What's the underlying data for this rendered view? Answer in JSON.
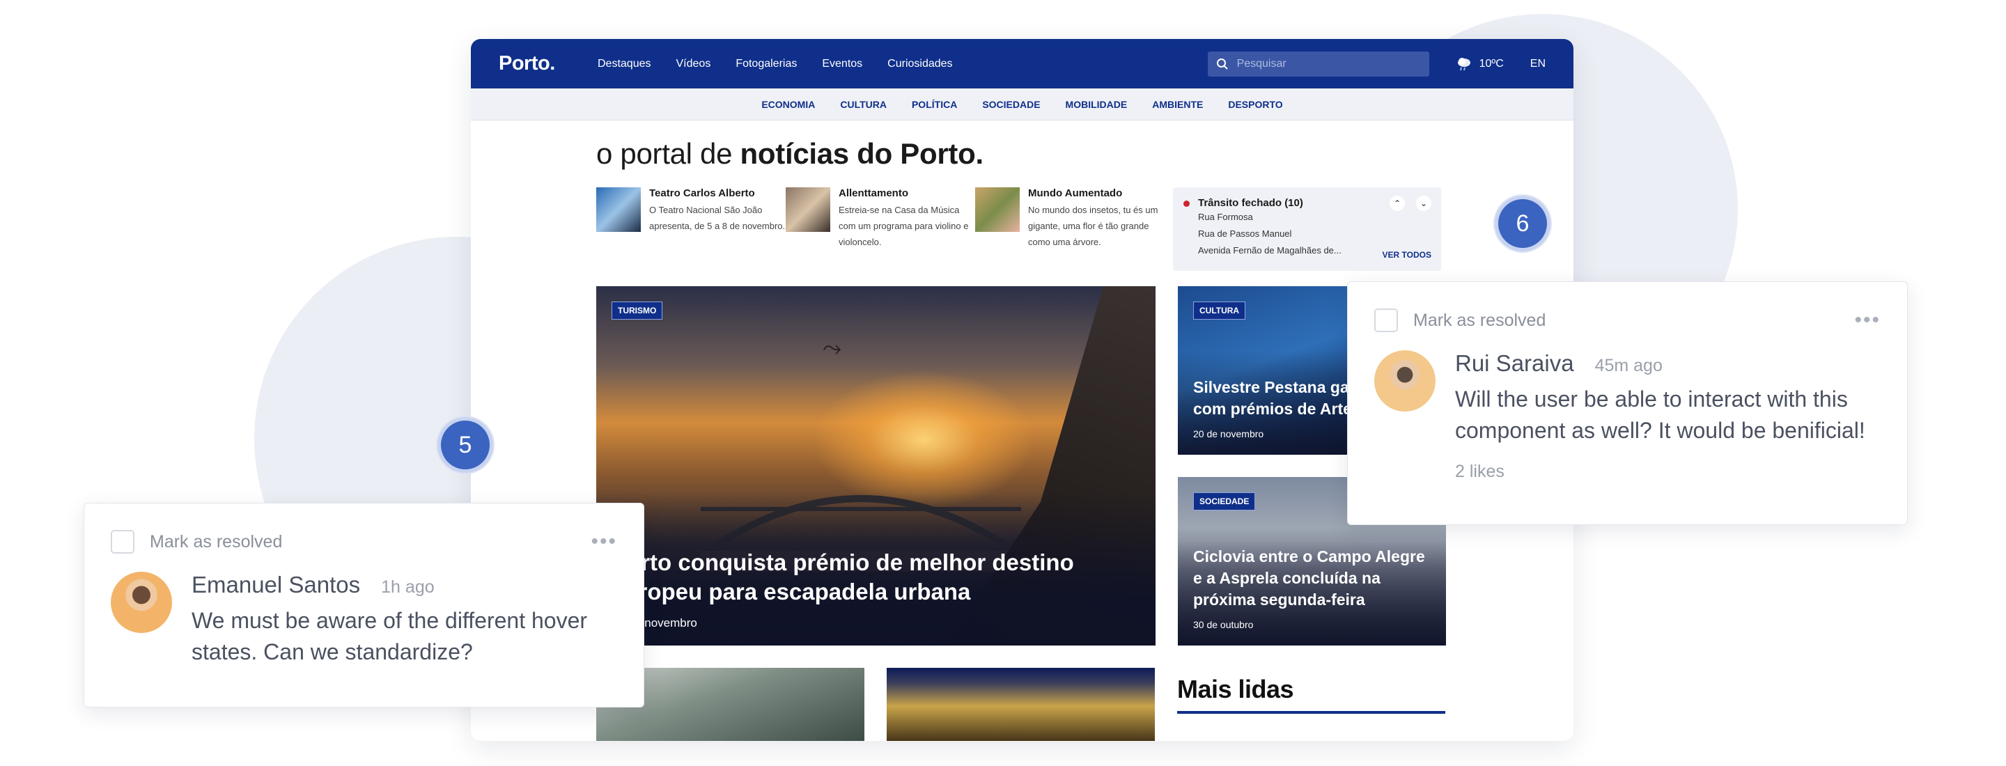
{
  "site": {
    "logo": "Porto.",
    "nav": [
      "Destaques",
      "Vídeos",
      "Fotogalerias",
      "Eventos",
      "Curiosidades"
    ],
    "search_placeholder": "Pesquisar",
    "weather": "10ºC",
    "lang": "EN",
    "categories": [
      "ECONOMIA",
      "CULTURA",
      "POLÍTICA",
      "SOCIEDADE",
      "MOBILIDADE",
      "AMBIENTE",
      "DESPORTO"
    ],
    "headline_light": "o portal de ",
    "headline_bold": "notícias do Porto.",
    "mini_news": [
      {
        "title": "Teatro Carlos Alberto",
        "text": "O Teatro Nacional São João apresenta, de 5 a 8 de novembro."
      },
      {
        "title": "Allenttamento",
        "text": "Estreia-se na Casa da Música com um programa para violino e violoncelo."
      },
      {
        "title": "Mundo Aumentado",
        "text": "No mundo dos insetos, tu és um gigante, uma flor é tão grande como uma árvore."
      }
    ],
    "traffic": {
      "title": "Trânsito fechado (10)",
      "rows": [
        "Rua Formosa",
        "Rua de Passos Manuel",
        "Avenida Fernão de Magalhães de..."
      ],
      "see_all": "VER TODOS"
    },
    "hero": {
      "tag": "TURISMO",
      "title": "Porto conquista prémio de melhor destino europeu para escapadela urbana",
      "date": "23 de novembro"
    },
    "side_cards": [
      {
        "tag": "CULTURA",
        "title": "Silvestre Pestana galardoado com prémios de Arte",
        "date": "20 de novembro"
      },
      {
        "tag": "SOCIEDADE",
        "title": "Ciclovia entre o Campo Alegre e a Asprela concluída na próxima segunda-feira",
        "date": "30 de outubro"
      }
    ],
    "most_read": "Mais lidas"
  },
  "badges": {
    "b5": "5",
    "b6": "6"
  },
  "comments": [
    {
      "resolve_label": "Mark as resolved",
      "author": "Emanuel Santos",
      "time": "1h ago",
      "text": "We must be aware of the different hover states. Can we standardize?"
    },
    {
      "resolve_label": "Mark as resolved",
      "author": "Rui Saraiva",
      "time": "45m ago",
      "text": "Will the user be able to interact with this component as well? It would be benificial!",
      "likes": "2 likes"
    }
  ],
  "colors": {
    "brand": "#0f2f8a",
    "badge": "#3b63c0",
    "alert": "#d0222d"
  }
}
